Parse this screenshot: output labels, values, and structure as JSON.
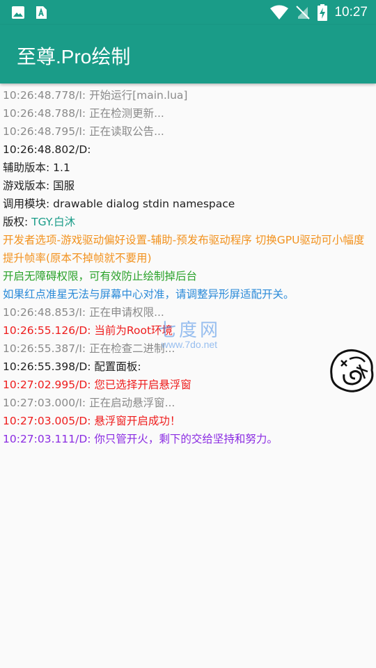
{
  "status_bar": {
    "left_icons": [
      "image-icon",
      "font-app-icon"
    ],
    "right_icons": [
      "wifi-icon",
      "no-sim-icon",
      "battery-charging-icon"
    ],
    "time": "10:27"
  },
  "app_bar": {
    "title": "至尊.Pro绘制"
  },
  "log": [
    {
      "text": "10:26:48.778/I: 开始运行[main.lua]",
      "color": "gray"
    },
    {
      "text": "10:26:48.788/I: 正在检测更新...",
      "color": "gray"
    },
    {
      "text": "10:26:48.795/I: 正在读取公告...",
      "color": "gray"
    },
    {
      "text": "10:26:48.802/D:",
      "color": "black"
    },
    {
      "text": "辅助版本: 1.1",
      "color": "black"
    },
    {
      "text": "游戏版本: 国服",
      "color": "black"
    },
    {
      "text": "调用模块: drawable dialog stdin namespace",
      "color": "black"
    },
    {
      "prefix": "版权: ",
      "value": "TGY.白沐"
    },
    {
      "text": "开发者选项-游戏驱动偏好设置-辅助-预发布驱动程序 切换GPU驱动可小幅度提升帧率(原本不掉帧就不要用)",
      "color": "orange"
    },
    {
      "text": "开启无障碍权限，可有效防止绘制掉后台",
      "color": "green"
    },
    {
      "text": "如果红点准星无法与屏幕中心对准，请调整异形屏适配开关。",
      "color": "blue"
    },
    {
      "text": "10:26:48.853/I: 正在申请权限...",
      "color": "gray"
    },
    {
      "text": "10:26:55.126/D: 当前为Root环境",
      "color": "red"
    },
    {
      "text": "10:26:55.387/I: 正在检查二进制...",
      "color": "gray"
    },
    {
      "text": "10:26:55.398/D: 配置面板:",
      "color": "black"
    },
    {
      "text": "10:27:02.995/D: 您已选择开启悬浮窗",
      "color": "red"
    },
    {
      "text": "10:27:03.000/I: 正在启动悬浮窗...",
      "color": "gray"
    },
    {
      "text": "10:27:03.005/D: 悬浮窗开启成功！",
      "color": "red"
    },
    {
      "text": "10:27:03.111/D: 你只管开火，剩下的交给坚持和努力。",
      "color": "purple"
    }
  ],
  "watermark": {
    "text": "七度网",
    "url": "www.7do.net"
  },
  "floating_button": {
    "icon": "floating-window-icon"
  },
  "colors": {
    "primary": "#1a9c88",
    "gray": "#8a8a8a",
    "black": "#1e1e1e",
    "orange": "#f2921f",
    "green": "#2aa22a",
    "blue": "#2a8ad8",
    "red": "#ee1c1c",
    "purple": "#8a2be2"
  }
}
